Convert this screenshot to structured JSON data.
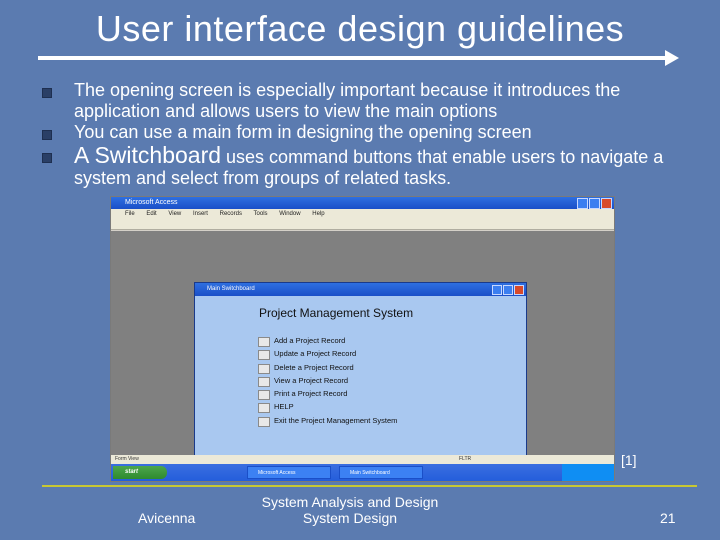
{
  "slide": {
    "title": "User interface design guidelines",
    "bullets": [
      {
        "text": "The opening screen is especially important because it introduces the application and allows users to view the main options"
      },
      {
        "text": "You can use a main form in designing the opening screen"
      },
      {
        "lead": "A Switchboard",
        "text": " uses command buttons that enable users to navigate a system and select from groups of related tasks."
      }
    ],
    "reference": "[1]"
  },
  "screenshot": {
    "app_title": "Microsoft Access",
    "menu": [
      "File",
      "Edit",
      "View",
      "Insert",
      "Records",
      "Tools",
      "Window",
      "Help"
    ],
    "switchboard": {
      "window_title": "Main Switchboard",
      "heading": "Project Management System",
      "items": [
        "Add a Project Record",
        "Update a Project Record",
        "Delete a Project Record",
        "View a Project Record",
        "Print a Project Record",
        "HELP",
        "Exit the Project Management System"
      ]
    },
    "status_left": "Form View",
    "status_right": "FLTR",
    "taskbar": {
      "start": "start",
      "tasks": [
        "Microsoft Access",
        "Main Switchboard"
      ]
    }
  },
  "footer": {
    "left": "Avicenna",
    "center_line1": "System Analysis and Design",
    "center_line2": "System Design",
    "page": "21"
  }
}
